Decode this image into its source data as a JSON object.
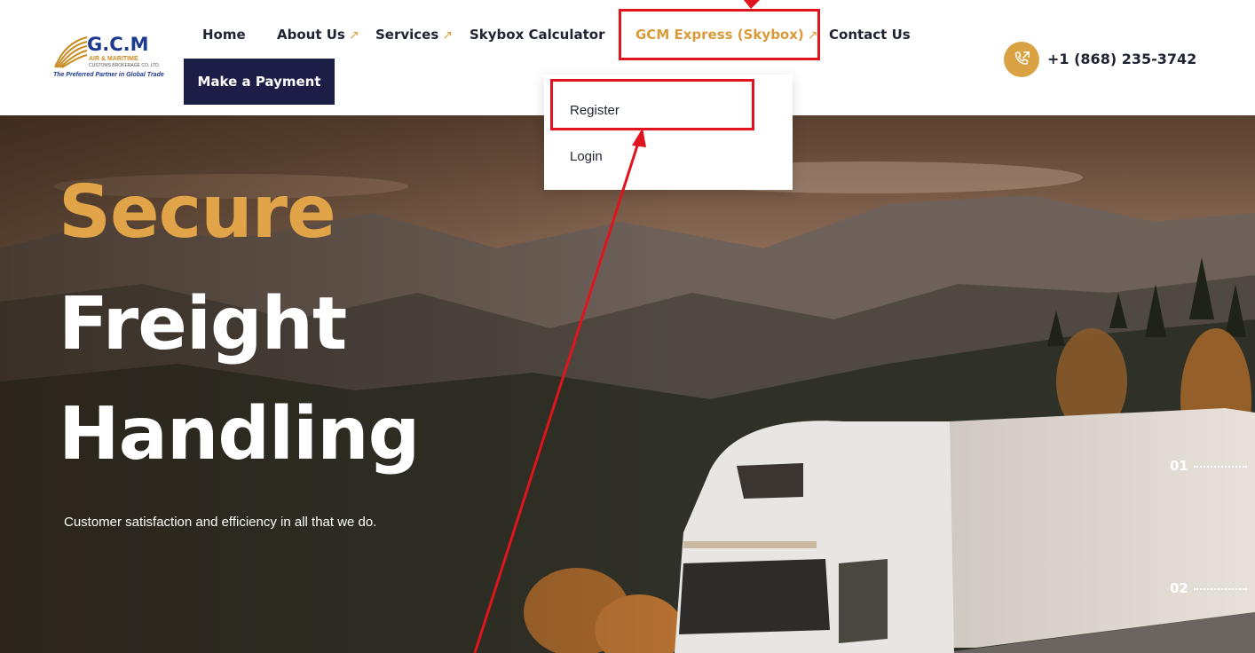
{
  "header": {
    "logo": {
      "name": "G.C.M",
      "sub1": "AIR & MARITIME",
      "sub2": "CUSTOMS BROKERAGE CO. LTD.",
      "tagline": "The Preferred Partner in Global Trade"
    },
    "nav": {
      "home": "Home",
      "about": "About Us",
      "services": "Services",
      "calculator": "Skybox Calculator",
      "gcm_express": "GCM Express (Skybox)",
      "contact": "Contact Us",
      "arrow_glyph": "↗"
    },
    "payment_button": "Make a Payment",
    "phone": "+1 (868) 235-3742"
  },
  "dropdown": {
    "register": "Register",
    "login": "Login"
  },
  "hero": {
    "line1": "Secure",
    "line2": "Freight",
    "line3": "Handling",
    "subtitle": "Customer satisfaction and efficiency in all that we do.",
    "slides": [
      "01",
      "02"
    ]
  },
  "colors": {
    "accent": "#e1a448",
    "navy": "#1d1e47",
    "annotation_red": "#e0141e"
  },
  "icons": {
    "phone": "phone-icon",
    "arrow": "arrow-up-right-icon"
  }
}
